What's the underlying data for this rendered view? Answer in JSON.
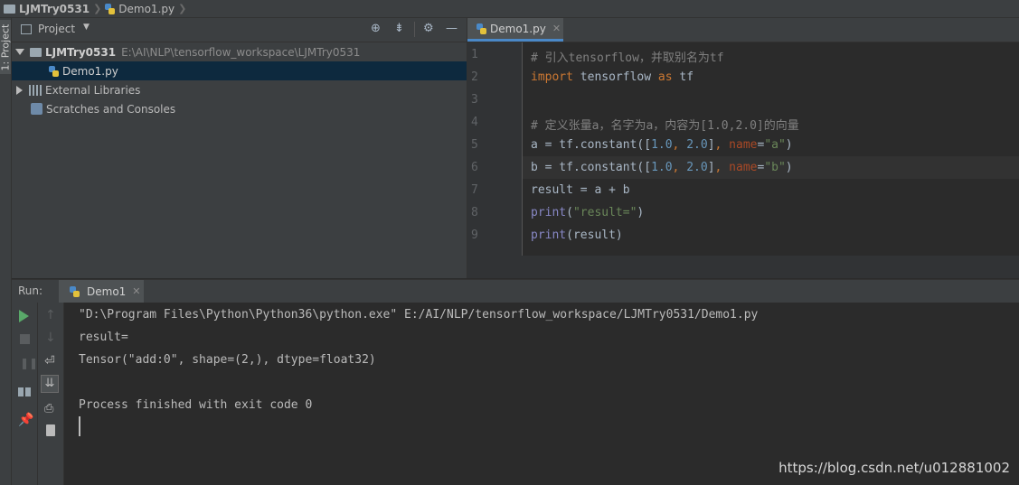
{
  "breadcrumb": {
    "project": "LJMTry0531",
    "file": "Demo1.py"
  },
  "left_stripe": {
    "tab_label": "1: Project"
  },
  "project_panel": {
    "title": "Project",
    "tree": [
      {
        "label": "LJMTry0531",
        "path": "E:\\AI\\NLP\\tensorflow_workspace\\LJMTry0531"
      },
      {
        "label": "Demo1.py"
      },
      {
        "label": "External Libraries"
      },
      {
        "label": "Scratches and Consoles"
      }
    ]
  },
  "editor": {
    "tab_label": "Demo1.py",
    "lines": [
      {
        "num": "1",
        "text": "# 引入tensorflow，并取别名为tf"
      },
      {
        "num": "2",
        "text": "import tensorflow as tf"
      },
      {
        "num": "3",
        "text": ""
      },
      {
        "num": "4",
        "text": "# 定义张量a，名字为a，内容为[1.0,2.0]的向量"
      },
      {
        "num": "5",
        "text": "a = tf.constant([1.0, 2.0], name=\"a\")"
      },
      {
        "num": "6",
        "text": "b = tf.constant([1.0, 2.0], name=\"b\")"
      },
      {
        "num": "7",
        "text": "result = a + b"
      },
      {
        "num": "8",
        "text": "print(\"result=\")"
      },
      {
        "num": "9",
        "text": "print(result)"
      }
    ]
  },
  "run_panel": {
    "label": "Run:",
    "tab_label": "Demo1",
    "output": [
      "\"D:\\Program Files\\Python\\Python36\\python.exe\" E:/AI/NLP/tensorflow_workspace/LJMTry0531/Demo1.py",
      "result=",
      "Tensor(\"add:0\", shape=(2,), dtype=float32)",
      "",
      "Process finished with exit code 0"
    ]
  },
  "watermark": "https://blog.csdn.net/u012881002",
  "colors": {
    "background": "#2b2b2b",
    "panel": "#3c3f41",
    "selection": "#0d293e",
    "keyword": "#cc7832",
    "string": "#6a8759",
    "number": "#6897bb",
    "comment": "#808080",
    "run_green": "#59a869"
  }
}
